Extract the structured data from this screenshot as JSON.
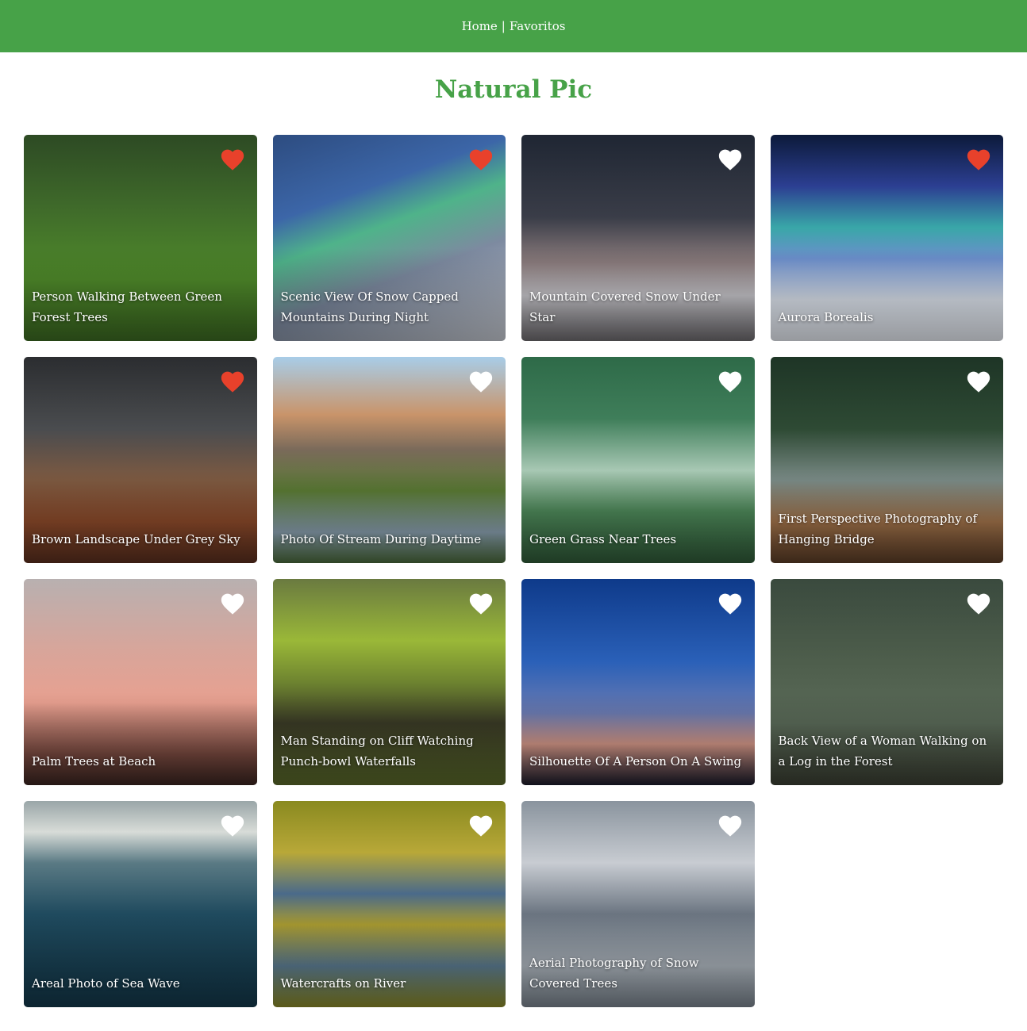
{
  "nav": {
    "home_label": "Home",
    "separator": "|",
    "favorites_label": "Favoritos"
  },
  "title": "Natural Pic",
  "colors": {
    "brand": "#47a248",
    "heart_liked": "#e8412b",
    "heart_unliked": "#ffffff"
  },
  "photos": [
    {
      "alt": "Person Walking Between Green Forest Trees",
      "liked": true,
      "bg": "linear-gradient(180deg,#2d4a24 0%,#3f6a2a 35%,#4f8a2a 70%,#3c6a22 100%)"
    },
    {
      "alt": "Scenic View Of Snow Capped Mountains During Night",
      "liked": true,
      "bg": "linear-gradient(160deg,#2d4c80 0%,#3c66a8 30%,#4fb38a 45%,#7d8aa0 65%,#c8ccd4 100%)"
    },
    {
      "alt": "Mountain Covered Snow Under Star",
      "liked": false,
      "bg": "linear-gradient(180deg,#1f2633 0%,#3a3d48 40%,#8a7b7c 62%,#c9c8cd 78%,#6d6a6e 100%)"
    },
    {
      "alt": "Aurora Borealis",
      "liked": true,
      "bg": "linear-gradient(180deg,#0c1a3a 0%,#2c3f92 25%,#39a7a8 45%,#6c8fcc 60%,#dfe6f0 80%,#e8ecf3 100%)"
    },
    {
      "alt": "Brown Landscape Under Grey Sky",
      "liked": true,
      "bg": "linear-gradient(180deg,#2b2d30 0%,#4a4c4f 35%,#7e5a41 60%,#8c4a2a 80%,#5a2e1e 100%)"
    },
    {
      "alt": "Photo Of Stream During Daytime",
      "liked": false,
      "bg": "linear-gradient(180deg,#a8cde8 0%,#c9946a 28%,#7a6a5a 45%,#5a7a34 65%,#8aa0b0 85%,#4a6a3a 100%)"
    },
    {
      "alt": "Green Grass Near Trees",
      "liked": false,
      "bg": "linear-gradient(180deg,#2e6a48 0%,#3f7e5a 30%,#a8c8b4 55%,#4e8a5a 75%,#2f5a38 100%)"
    },
    {
      "alt": "First Perspective Photography of Hanging Bridge",
      "liked": false,
      "bg": "linear-gradient(180deg,#1e3526 0%,#2e4a34 35%,#7a8a86 60%,#a2734a 80%,#5a3c26 100%)"
    },
    {
      "alt": "Palm Trees at Beach",
      "liked": false,
      "bg": "linear-gradient(180deg,#b8b0b0 0%,#d8a59a 35%,#e8a090 60%,#7a4a40 85%,#3a2420 100%)"
    },
    {
      "alt": "Man Standing on Cliff Watching Punch-bowl Waterfalls",
      "liked": false,
      "bg": "linear-gradient(180deg,#6a7a40 0%,#9ab838 30%,#6e8430 50%,#3a3a26 70%,#5a6a2a 100%)"
    },
    {
      "alt": "Silhouette Of A Person On A Swing",
      "liked": false,
      "bg": "linear-gradient(180deg,#0e3a8a 0%,#2a60b8 40%,#6a7ab0 65%,#d89a8a 80%,#1a1a2a 100%)"
    },
    {
      "alt": "Back View of a Woman Walking on a Log in the Forest",
      "liked": false,
      "bg": "linear-gradient(180deg,#3a4a3e 0%,#4e5e4c 40%,#5a6a58 70%,#3a3e32 100%)"
    },
    {
      "alt": "Areal Photo of Sea Wave",
      "liked": false,
      "bg": "linear-gradient(180deg,#9aa6a8 0%,#d8dcd8 15%,#5a7a84 30%,#1f4a5e 55%,#13384a 100%)"
    },
    {
      "alt": "Watercrafts on River",
      "liked": false,
      "bg": "linear-gradient(180deg,#8a8a20 0%,#b8a838 25%,#4a6a8a 45%,#a89a30 60%,#5a7a90 80%,#8a8a28 100%)"
    },
    {
      "alt": "Aerial Photography of Snow Covered Trees",
      "liked": false,
      "bg": "linear-gradient(180deg,#8a949e 0%,#c8ccd2 30%,#6a7480 55%,#aab2ba 80%,#7a848e 100%)"
    }
  ]
}
